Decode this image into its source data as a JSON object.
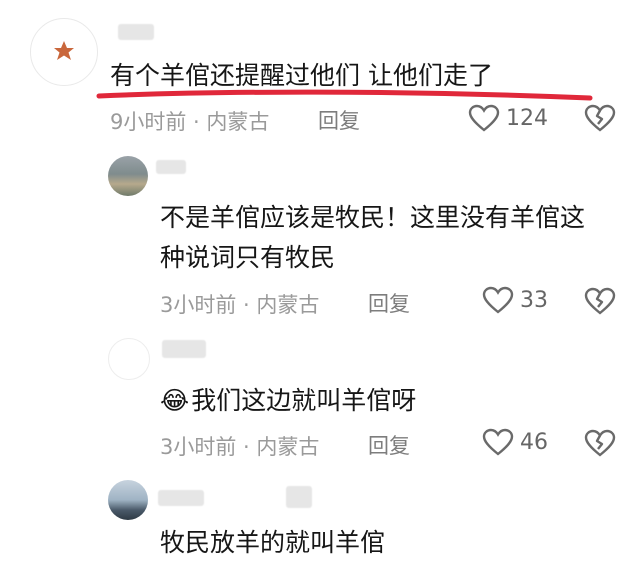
{
  "comments": [
    {
      "text": "有个羊倌还提醒过他们 让他们走了",
      "meta": "9小时前 · 内蒙古",
      "reply_label": "回复",
      "likes": "124"
    },
    {
      "text_line1": "不是羊倌应该是牧民！这里没有羊倌这",
      "text_line2": "种说词只有牧民",
      "meta": "3小时前 · 内蒙古",
      "reply_label": "回复",
      "likes": "33"
    },
    {
      "emoji": "😂",
      "text": "我们这边就叫羊倌呀",
      "meta": "3小时前 · 内蒙古",
      "reply_label": "回复",
      "likes": "46"
    },
    {
      "text": "牧民放羊的就叫羊倌"
    }
  ],
  "colors": {
    "highlight_underline": "#e0283a",
    "meta_text": "#9a9a9a",
    "icon": "#6a6a6a"
  },
  "icons": [
    "heart-outline-icon",
    "broken-heart-icon"
  ]
}
